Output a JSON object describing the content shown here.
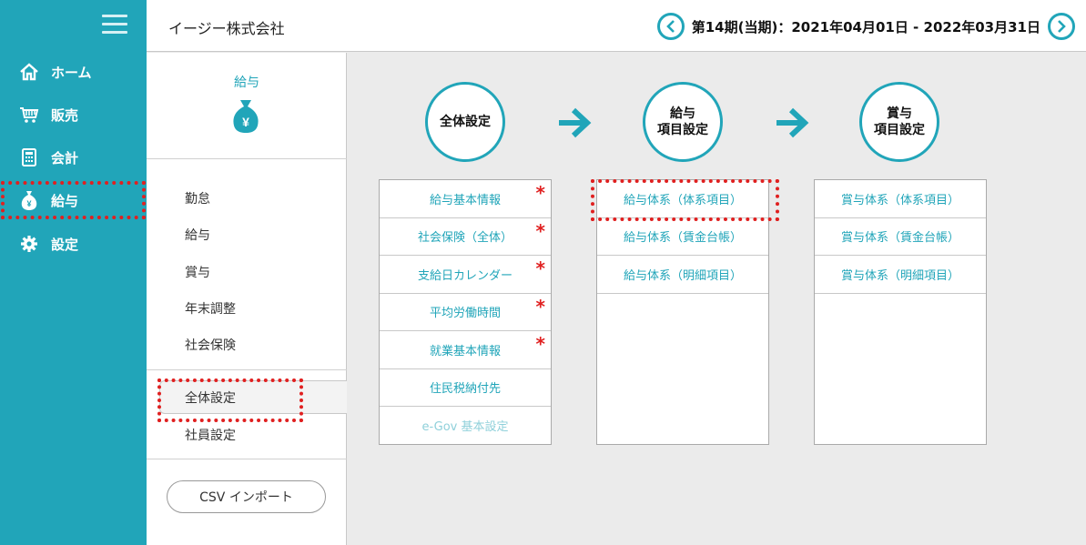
{
  "nav": {
    "items": [
      {
        "label": "ホーム",
        "icon": "home-icon"
      },
      {
        "label": "販売",
        "icon": "cart-icon"
      },
      {
        "label": "会計",
        "icon": "calculator-icon"
      },
      {
        "label": "給与",
        "icon": "money-bag-icon",
        "active": true
      },
      {
        "label": "設定",
        "icon": "gear-icon"
      }
    ]
  },
  "header": {
    "company": "イージー株式会社",
    "period": "第14期(当期)：2021年04月01日 - 2022年03月31日"
  },
  "subnav": {
    "title": "給与",
    "items": [
      "勤怠",
      "給与",
      "賞与",
      "年末調整",
      "社会保険"
    ],
    "selected": "全体設定",
    "after": [
      "社員設定"
    ],
    "csv_button": "CSV インポート"
  },
  "steps": [
    {
      "label": "全体設定"
    },
    {
      "label": "給与\n項目設定"
    },
    {
      "label": "賞与\n項目設定"
    }
  ],
  "panels": {
    "general": [
      {
        "label": "給与基本情報",
        "required": true
      },
      {
        "label": "社会保険（全体）",
        "required": true
      },
      {
        "label": "支給日カレンダー",
        "required": true
      },
      {
        "label": "平均労働時間",
        "required": true
      },
      {
        "label": "就業基本情報",
        "required": true
      },
      {
        "label": "住民税納付先",
        "required": false
      },
      {
        "label": "e-Gov 基本設定",
        "required": false,
        "disabled": true
      }
    ],
    "salary": [
      {
        "label": "給与体系（体系項目）"
      },
      {
        "label": "給与体系（賃金台帳）"
      },
      {
        "label": "給与体系（明細項目）"
      }
    ],
    "bonus": [
      {
        "label": "賞与体系（体系項目）"
      },
      {
        "label": "賞与体系（賃金台帳）"
      },
      {
        "label": "賞与体系（明細項目）"
      }
    ]
  },
  "required_mark": "*",
  "colors": {
    "accent": "#21a5b9",
    "required": "#e02020",
    "highlight": "#e02020"
  }
}
